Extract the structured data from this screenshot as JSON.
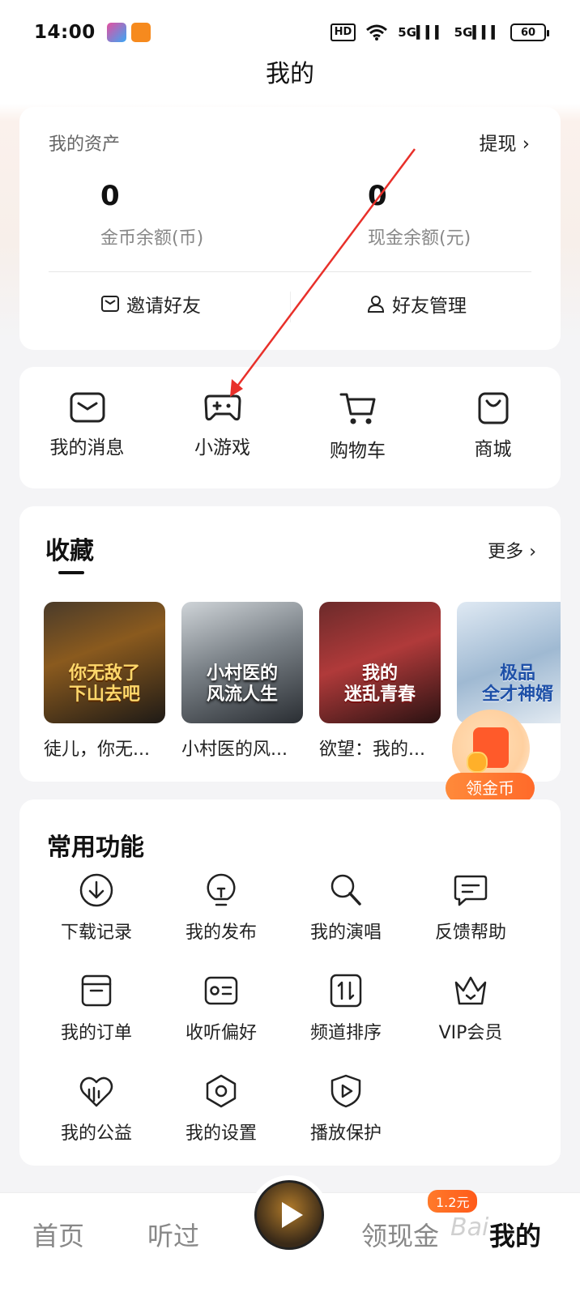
{
  "status_bar": {
    "time": "14:00",
    "hd": "HD",
    "net1": "5G",
    "net2": "5G",
    "battery": "60"
  },
  "page_title": "我的",
  "assets": {
    "title": "我的资产",
    "withdraw": "提现",
    "coin_value": "0",
    "coin_label": "金币余额(币)",
    "cash_value": "0",
    "cash_label": "现金余额(元)",
    "invite": "邀请好友",
    "manage_friends": "好友管理"
  },
  "quick_entries": [
    {
      "label": "我的消息",
      "icon": "message-icon"
    },
    {
      "label": "小游戏",
      "icon": "gamepad-icon"
    },
    {
      "label": "购物车",
      "icon": "cart-icon"
    },
    {
      "label": "商城",
      "icon": "shopping-bag-icon"
    }
  ],
  "favorites": {
    "title": "收藏",
    "more": "更多",
    "books": [
      {
        "title": "徒儿，你无...",
        "cover_text": "你无敌了\n下山去吧"
      },
      {
        "title": "小村医的风...",
        "cover_text": "小村医的\n风流人生"
      },
      {
        "title": "欲望：我的...",
        "cover_text": "我的\n迷乱青春"
      },
      {
        "title": "神",
        "cover_text": "极品\n全才神婿"
      }
    ]
  },
  "coin_float": {
    "label": "领金币"
  },
  "functions": {
    "title": "常用功能",
    "items": [
      {
        "label": "下载记录",
        "icon": "download-icon"
      },
      {
        "label": "我的发布",
        "icon": "lightbulb-icon"
      },
      {
        "label": "我的演唱",
        "icon": "microphone-icon"
      },
      {
        "label": "反馈帮助",
        "icon": "feedback-icon"
      },
      {
        "label": "我的订单",
        "icon": "order-box-icon"
      },
      {
        "label": "收听偏好",
        "icon": "preference-card-icon"
      },
      {
        "label": "频道排序",
        "icon": "sort-icon"
      },
      {
        "label": "VIP会员",
        "icon": "crown-icon"
      },
      {
        "label": "我的公益",
        "icon": "charity-heart-icon"
      },
      {
        "label": "我的设置",
        "icon": "settings-hex-icon"
      },
      {
        "label": "播放保护",
        "icon": "play-shield-icon"
      }
    ]
  },
  "bottom_nav": {
    "home": "首页",
    "history": "听过",
    "cash": "领现金",
    "cash_badge": "1.2元",
    "mine": "我的",
    "watermark": "Bai"
  },
  "colors": {
    "accent": "#ff6a2a",
    "annotation": "#e8302a"
  }
}
